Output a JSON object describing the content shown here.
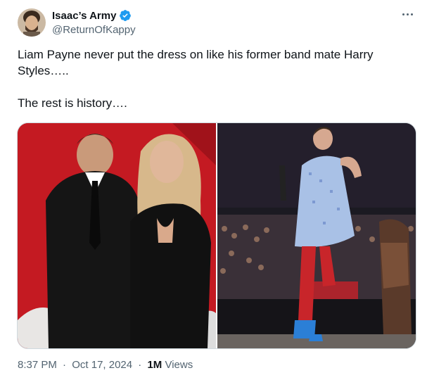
{
  "author": {
    "display_name": "Isaac’s Army",
    "handle": "@ReturnOfKappy",
    "verified": true,
    "verified_color": "#1d9bf0"
  },
  "tweet": {
    "text": "Liam Payne never put the dress on like his former band mate Harry Styles…..\n\nThe rest is history…."
  },
  "media": {
    "count": 2
  },
  "meta": {
    "time": "8:37 PM",
    "date": "Oct 17, 2024",
    "separator": "·",
    "views_count": "1M",
    "views_label": "Views"
  },
  "icons": {
    "more": "more-horizontal-icon",
    "verified": "verified-badge-icon"
  }
}
